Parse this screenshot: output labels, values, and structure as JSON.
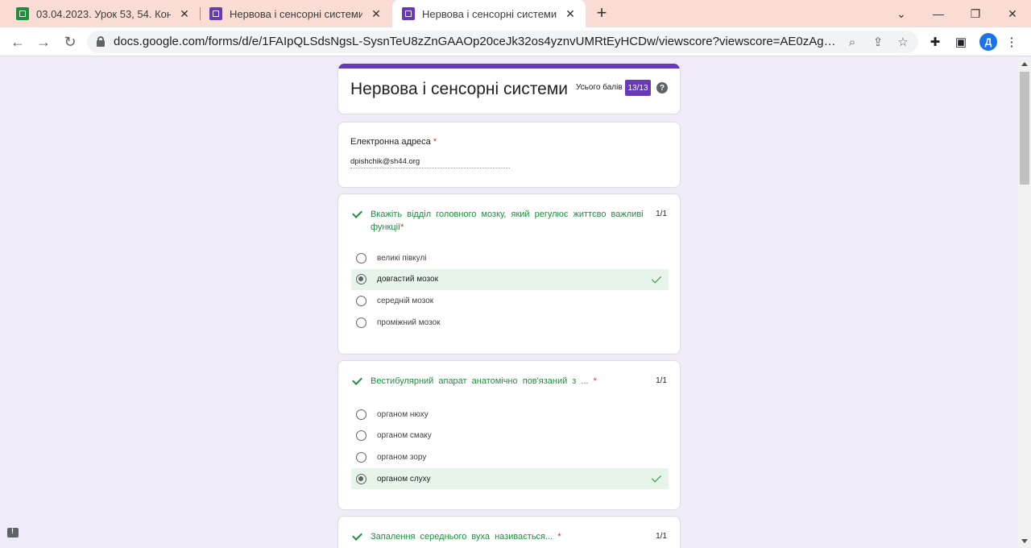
{
  "browser": {
    "tabs": [
      {
        "title": "03.04.2023. Урок 53, 54. Контрол",
        "icon": "sheets-icon",
        "active": false
      },
      {
        "title": "Нервова і сенсорні системи",
        "icon": "forms-icon",
        "active": false
      },
      {
        "title": "Нервова і сенсорні системи",
        "icon": "forms-icon",
        "active": true
      }
    ],
    "url": "docs.google.com/forms/d/e/1FAIpQLSdsNgsL-SysnTeU8zZnGAAOp20ceJk32os4yznvUMRtEyHCDw/viewscore?viewscore=AE0zAgBIiC-5GfycxRG...",
    "profile_initial": "Д"
  },
  "form": {
    "title": "Нервова і сенсорні системи",
    "total_label": "Усього балів",
    "score": "13/13",
    "accent_color": "#673ab7",
    "correct_color": "#1e8e3e"
  },
  "email": {
    "label": "Електронна адреса",
    "required_mark": "*",
    "value": "dpishchik@sh44.org"
  },
  "questions": [
    {
      "text": "Вкажіть відділ головного мозку, який регулює життєво важливі функції",
      "required_mark": "*",
      "points": "1/1",
      "options": [
        "великі півкулі",
        "довгастий мозок",
        "середній мозок",
        "проміжний мозок"
      ],
      "selected_index": 1
    },
    {
      "text": "Вестибулярний апарат анатомічно пов'язаний з ...",
      "required_mark": "*",
      "points": "1/1",
      "options": [
        "органом нюху",
        "органом смаку",
        "органом зору",
        "органом слуху"
      ],
      "selected_index": 3
    },
    {
      "text": "Запалення середнього вуха називається...",
      "required_mark": "*",
      "points": "1/1"
    }
  ]
}
